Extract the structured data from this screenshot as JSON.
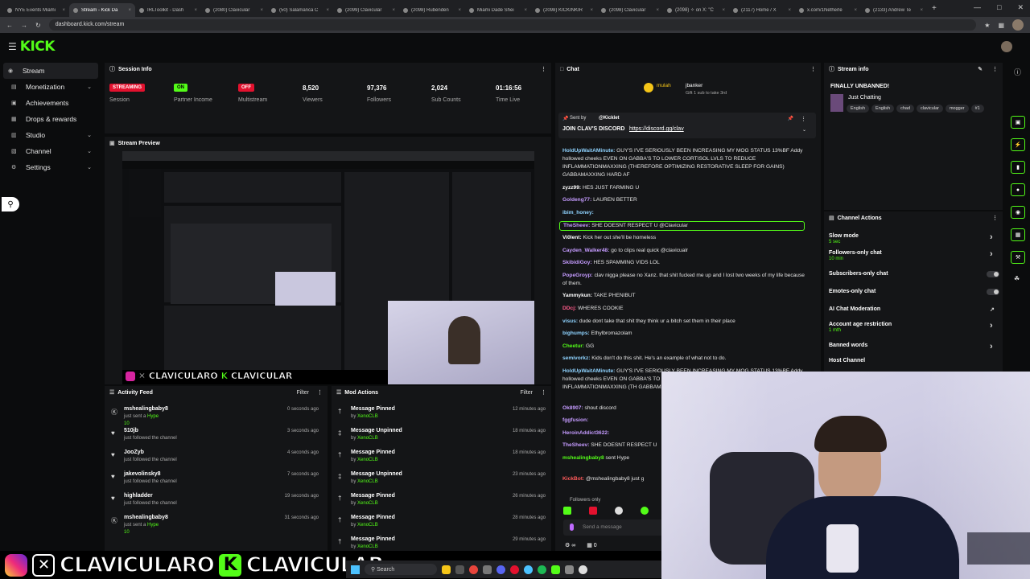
{
  "browser": {
    "tabs": [
      {
        "label": "NYE Events Miami",
        "active": false
      },
      {
        "label": "Stream - Kick Da",
        "active": true
      },
      {
        "label": "IRLToolkit - Dash",
        "active": false
      },
      {
        "label": "(2080) Clavicular",
        "active": false
      },
      {
        "label": "(50) Salamanca C",
        "active": false
      },
      {
        "label": "(2099) Clavicular",
        "active": false
      },
      {
        "label": "(2098) Rubenden",
        "active": false
      },
      {
        "label": "Miami Dade Shei",
        "active": false
      },
      {
        "label": "(2098) KICKINKIR",
        "active": false
      },
      {
        "label": "(2098) Clavicular",
        "active": false
      },
      {
        "label": "(2098) ✧ on X: \"C",
        "active": false
      },
      {
        "label": "(2117) Home / X",
        "active": false
      },
      {
        "label": "x.com/1Netherle",
        "active": false
      },
      {
        "label": "(2133) Andrew Te",
        "active": false
      }
    ],
    "url": "dashboard.kick.com/stream"
  },
  "brand": {
    "logo": "KICK",
    "accent": "#53fc18"
  },
  "sidebar": {
    "items": [
      {
        "label": "Stream",
        "icon": "broadcast-icon",
        "active": true,
        "expand": false
      },
      {
        "label": "Monetization",
        "icon": "money-icon",
        "active": false,
        "expand": true
      },
      {
        "label": "Achievements",
        "icon": "trophy-icon",
        "active": false,
        "expand": false
      },
      {
        "label": "Drops & rewards",
        "icon": "gift-icon",
        "active": false,
        "expand": false
      },
      {
        "label": "Studio",
        "icon": "studio-icon",
        "active": false,
        "expand": true
      },
      {
        "label": "Channel",
        "icon": "channel-icon",
        "active": false,
        "expand": true
      },
      {
        "label": "Settings",
        "icon": "gear-icon",
        "active": false,
        "expand": true
      }
    ]
  },
  "session": {
    "title": "Session Info",
    "stats": [
      {
        "value": "STREAMING",
        "label": "Session",
        "kind": "red"
      },
      {
        "value": "ON",
        "label": "Partner Income",
        "kind": "green"
      },
      {
        "value": "OFF",
        "label": "Multistream",
        "kind": "red"
      },
      {
        "value": "8,520",
        "label": "Viewers",
        "kind": "text"
      },
      {
        "value": "97,376",
        "label": "Followers",
        "kind": "text"
      },
      {
        "value": "2,024",
        "label": "Sub Counts",
        "kind": "text"
      },
      {
        "value": "01:16:56",
        "label": "Time Live",
        "kind": "text"
      }
    ]
  },
  "preview": {
    "title": "Stream Preview",
    "overlay_text": "CLAVICULARO",
    "overlay_text2": "CLAVICULAR"
  },
  "chat": {
    "title": "Chat",
    "leader": {
      "name": "mulah",
      "name2": "jbanker",
      "gift_text": "Gift 1 sub to take 3rd"
    },
    "pinned": {
      "sent_by": "Sent by",
      "author": "@Kicklet",
      "text": "JOIN CLAV'S DISCORD",
      "link": "https://discord.gg/clav"
    },
    "messages": [
      {
        "user": "HoldUpWaitAMinute:",
        "color": "#8fd3ff",
        "text": "GUY'S I'VE SERIOUSLY BEEN INCREASING MY MOG STATUS 13%BF Addy hollowed cheeks EVEN ON GABBA'S TO LOWER CORTISOL LVLS TO REDUCE INFLAMMATIONMAXXING (THEREFORE OPTIMIZING RESTORATIVE SLEEP FOR GAINS) GABBAMAXXING HARD AF",
        "lines": 4
      },
      {
        "user": "zyzz99:",
        "color": "#ffffff",
        "text": "HES JUST FARMING U",
        "lines": 1
      },
      {
        "user": "Goldeng77:",
        "color": "#c59bff",
        "text": "LAUREN BETTER",
        "lines": 1
      },
      {
        "user": "ibim_honey:",
        "color": "#8fd3ff",
        "text": "",
        "lines": 1
      },
      {
        "user": "TheSheev:",
        "color": "#c59bff",
        "text": "SHE DOESNT RESPECT U @Clavicular",
        "lines": 1
      },
      {
        "user": "Vi0lent:",
        "color": "#ffffff",
        "text": "Kick her out she'll be homeless",
        "lines": 1
      },
      {
        "user": "Cayden_Walker48:",
        "color": "#c59bff",
        "text": "go to clips real quick @clavicualr",
        "lines": 1
      },
      {
        "user": "SkibidiGoy:",
        "color": "#c59bff",
        "text": "HES SPAMMING VIDS LOL",
        "lines": 1
      },
      {
        "user": "PopeGroyp:",
        "color": "#c59bff",
        "text": "clav nigga please no Xanz. that shit fucked me up and I lost two weeks of my life because of them.",
        "lines": 2
      },
      {
        "user": "Yammykun:",
        "color": "#ffffff",
        "text": "TAKE PHENIBUT",
        "lines": 1
      },
      {
        "user": "DDcj:",
        "color": "#ff5a8a",
        "text": "WHERES COOKIE",
        "lines": 1
      },
      {
        "user": "visus:",
        "color": "#8fd3ff",
        "text": "dude dont take that shit they think ur a bitch set them in their place",
        "lines": 1
      },
      {
        "user": "bighumps:",
        "color": "#8fd3ff",
        "text": "Ethylbromazolam",
        "lines": 1
      },
      {
        "user": "Cheetur:",
        "color": "#53fc18",
        "text": "GG",
        "lines": 1
      },
      {
        "user": "semivorkz:",
        "color": "#8fd3ff",
        "text": "Kids don't do this shit. He's an example of what not to do.",
        "lines": 1
      },
      {
        "user": "HoldUpWaitAMinute:",
        "color": "#8fd3ff",
        "text": "GUY'S I'VE SERIOUSLY BEEN INCREASING MY MOG STATUS 13%BF Addy hollowed cheeks EVEN ON GABBA'S TO LOWER CORTISOL LVLS TO REDUCE INFLAMMATIONMAXXING (TH GABBAMAXXING HARD A",
        "lines": 4
      },
      {
        "user": "Ok8907:",
        "color": "#c59bff",
        "text": "shout discord",
        "lines": 1
      },
      {
        "user": "fggfusion:",
        "color": "#c59bff",
        "text": "",
        "lines": 1
      },
      {
        "user": "HeroinAddict3622:",
        "color": "#c59bff",
        "text": "",
        "lines": 1
      },
      {
        "user": "TheSheev:",
        "color": "#c59bff",
        "text": "SHE DOESNT RESPECT U",
        "lines": 1
      },
      {
        "user": "mshealingbaby8",
        "color": "#53fc18",
        "text": "sent Hype",
        "lines": 2
      },
      {
        "user": "KickBot:",
        "color": "#ff5a5a",
        "text": "@mshealingbaby8 just g",
        "lines": 1
      }
    ],
    "followers_only": "Followers only",
    "send_placeholder": "Send a message",
    "bottom_count1": "∞",
    "bottom_count2": "0"
  },
  "stream_info": {
    "title": "Stream info",
    "stream_title": "FINALLY UNBANNED!",
    "category": "Just Chatting",
    "tags": [
      "English",
      "English",
      "chad",
      "clavicular",
      "mogger",
      "#1"
    ]
  },
  "channel_actions": {
    "title": "Channel Actions",
    "items": [
      {
        "label": "Slow mode",
        "sub": "5 sec",
        "control": "arrow"
      },
      {
        "label": "Followers-only chat",
        "sub": "10 min",
        "control": "arrow"
      },
      {
        "label": "Subscribers-only chat",
        "sub": "",
        "control": "toggle"
      },
      {
        "label": "Emotes-only chat",
        "sub": "",
        "control": "toggle"
      },
      {
        "label": "AI Chat Moderation",
        "sub": "",
        "control": "external"
      },
      {
        "label": "Account age restriction",
        "sub": "1 mth",
        "control": "arrow"
      },
      {
        "label": "Banned words",
        "sub": "",
        "control": "arrow"
      },
      {
        "label": "Host Channel",
        "sub": "",
        "control": "none"
      }
    ]
  },
  "activity_feed": {
    "title": "Activity Feed",
    "filter_label": "Filter",
    "items": [
      {
        "name": "mshealingbaby8",
        "action": "just sent a",
        "highlight": "Hype",
        "extra": "10",
        "time": "0 seconds ago",
        "icon": "kick-icon"
      },
      {
        "name": "510jb",
        "action": "just followed the channel",
        "highlight": "",
        "extra": "",
        "time": "3 seconds ago",
        "icon": "heart-icon"
      },
      {
        "name": "JooZyb",
        "action": "just followed the channel",
        "highlight": "",
        "extra": "",
        "time": "4 seconds ago",
        "icon": "heart-icon"
      },
      {
        "name": "jakevolinsky8",
        "action": "just followed the channel",
        "highlight": "",
        "extra": "",
        "time": "7 seconds ago",
        "icon": "heart-icon"
      },
      {
        "name": "highladder",
        "action": "just followed the channel",
        "highlight": "",
        "extra": "",
        "time": "19 seconds ago",
        "icon": "heart-icon"
      },
      {
        "name": "mshealingbaby8",
        "action": "just sent a",
        "highlight": "Hype",
        "extra": "10",
        "time": "31 seconds ago",
        "icon": "kick-icon"
      }
    ]
  },
  "mod_actions": {
    "title": "Mod Actions",
    "filter_label": "Filter",
    "items": [
      {
        "name": "Message Pinned",
        "by": "by",
        "mod": "XenoCLB",
        "time": "12 minutes ago",
        "icon": "pin-icon"
      },
      {
        "name": "Message Unpinned",
        "by": "by",
        "mod": "XenoCLB",
        "time": "18 minutes ago",
        "icon": "unpin-icon"
      },
      {
        "name": "Message Pinned",
        "by": "by",
        "mod": "XenoCLB",
        "time": "18 minutes ago",
        "icon": "pin-icon"
      },
      {
        "name": "Message Unpinned",
        "by": "by",
        "mod": "XenoCLB",
        "time": "23 minutes ago",
        "icon": "unpin-icon"
      },
      {
        "name": "Message Pinned",
        "by": "by",
        "mod": "XenoCLB",
        "time": "26 minutes ago",
        "icon": "pin-icon"
      },
      {
        "name": "Message Pinned",
        "by": "by",
        "mod": "XenoCLB",
        "time": "28 minutes ago",
        "icon": "pin-icon"
      },
      {
        "name": "Message Pinned",
        "by": "by",
        "mod": "XenoCLB",
        "time": "29 minutes ago",
        "icon": "pin-icon"
      }
    ]
  },
  "overlay": {
    "name1": "CLAVICULARO",
    "name2": "CLAVICULAR"
  },
  "taskbar": {
    "search_placeholder": "Search"
  }
}
